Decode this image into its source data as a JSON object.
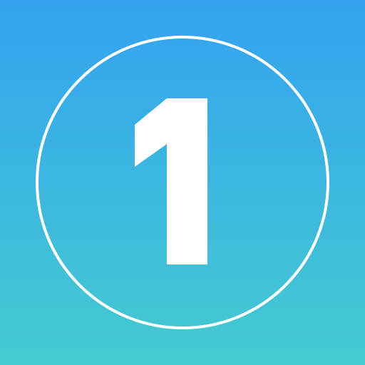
{
  "icon": {
    "numeral": "1",
    "glyph_name": "number-one",
    "colors": {
      "gradient_top": "#34a2f0",
      "gradient_bottom": "#45cbd0",
      "foreground": "#ffffff"
    }
  }
}
